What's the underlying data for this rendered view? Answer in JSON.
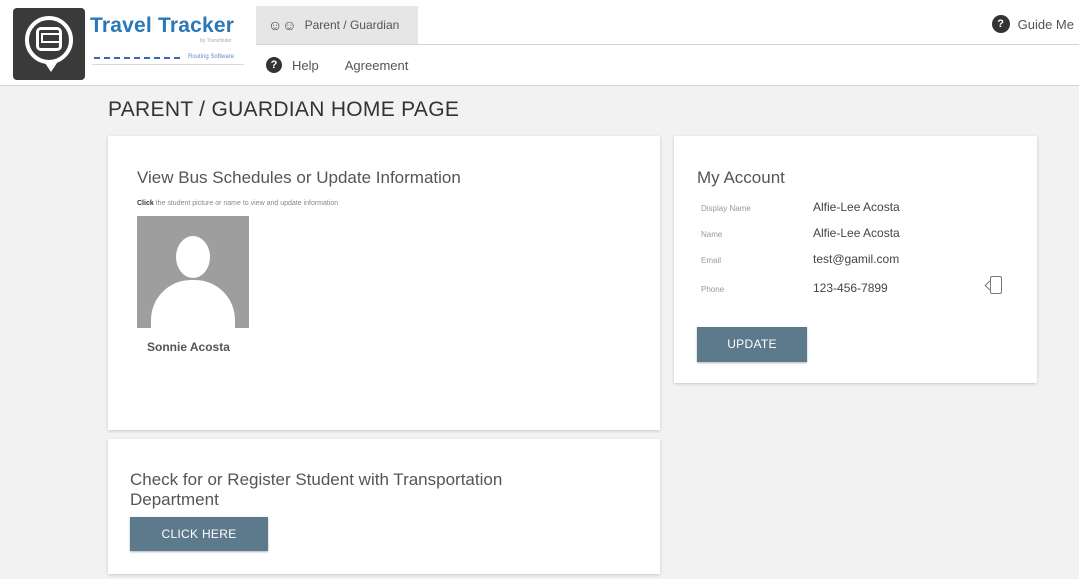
{
  "header": {
    "brand_title": "Travel Tracker",
    "brand_subtitle": "by Transfinder",
    "brand_tagline": "Routing Software",
    "tab_active_label": "Parent / Guardian",
    "guide_label": "Guide Me",
    "nav": [
      {
        "label": "Help"
      },
      {
        "label": "Agreement"
      }
    ]
  },
  "page_title": "PARENT / GUARDIAN HOME PAGE",
  "bus_card": {
    "title": "View Bus Schedules or Update Information",
    "hint_bold": "Click",
    "hint_rest": "the student picture or name to view and update information",
    "student_name": "Sonnie Acosta"
  },
  "account": {
    "title": "My Account",
    "rows": [
      {
        "label": "Display Name",
        "value": "Alfie-Lee Acosta"
      },
      {
        "label": "Name",
        "value": "Alfie-Lee Acosta"
      },
      {
        "label": "Email",
        "value": "test@gamil.com"
      },
      {
        "label": "Phone",
        "value": "123-456-7899"
      }
    ],
    "update_label": "UPDATE"
  },
  "register_card": {
    "title": "Check for or Register Student with Transportation Department",
    "button_label": "CLICK HERE"
  },
  "colors": {
    "brand_blue": "#2b78b8",
    "button": "#5d7a8c",
    "page_bg": "#f2f2f2"
  }
}
